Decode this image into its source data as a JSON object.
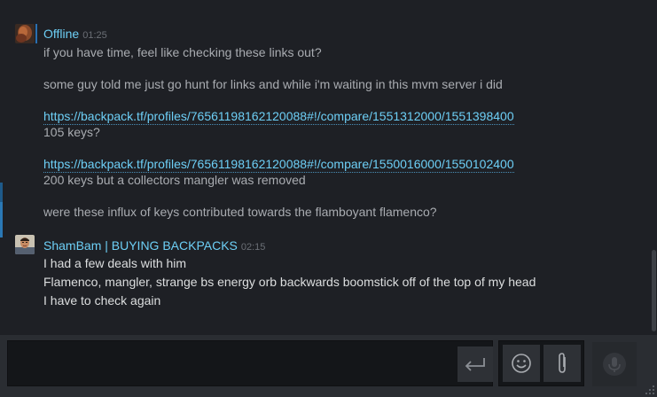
{
  "messages": [
    {
      "sender": "Offline",
      "time": "01:25",
      "lines": [
        {
          "text": "if you have time, feel like checking these links out?"
        },
        {
          "text": "some guy told me just go hunt for links and while i'm waiting in this mvm server i did"
        },
        {
          "link": "https://backpack.tf/profiles/76561198162120088#!/compare/1551312000/1551398400"
        },
        {
          "text": "105 keys?"
        },
        {
          "link": "https://backpack.tf/profiles/76561198162120088#!/compare/1550016000/1550102400"
        },
        {
          "text": "200 keys but a collectors mangler was removed"
        },
        {
          "text": "were these influx of keys contributed towards the flamboyant flamenco?"
        }
      ]
    },
    {
      "sender": "ShamBam | BUYING BACKPACKS",
      "time": "02:15",
      "lines": [
        {
          "text": "I had a few deals with him"
        },
        {
          "text": "Flamenco, mangler, strange bs energy orb backwards boomstick off of the top of my head"
        },
        {
          "text": "I have to check again"
        }
      ]
    }
  ],
  "composer": {
    "value": "",
    "placeholder": ""
  },
  "icons": {
    "send": "send-enter-icon",
    "emoji": "smiley-face-icon",
    "attach": "paperclip-icon",
    "voice": "microphone-icon"
  },
  "colors": {
    "background": "#1e2025",
    "link": "#6dcff6",
    "text": "#a9acb1",
    "composer": "#2a2d32"
  }
}
